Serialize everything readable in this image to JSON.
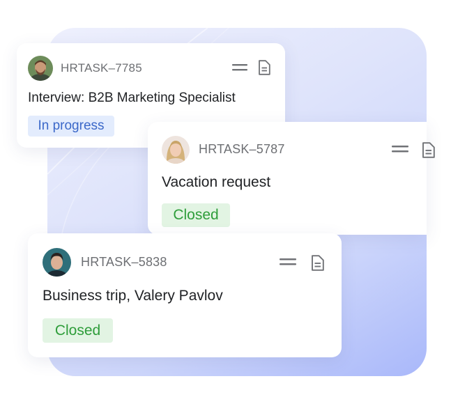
{
  "colors": {
    "badge_in_progress_bg": "#e3ecfd",
    "badge_in_progress_text": "#3b68c9",
    "badge_closed_bg": "#e2f4e3",
    "badge_closed_text": "#2e9d3a",
    "backdrop_accent": "#a9b8fa"
  },
  "cards": [
    {
      "task_id": "HRTASK–7785",
      "title": "Interview: B2B Marketing Specialist",
      "status": "In progress",
      "avatar": "man-with-beard-avatar",
      "icons": [
        "drag-handle-icon",
        "document-icon"
      ]
    },
    {
      "task_id": "HRTASK–5787",
      "title": "Vacation request",
      "status": "Closed",
      "avatar": "woman-blonde-avatar",
      "icons": [
        "drag-handle-icon",
        "document-icon"
      ]
    },
    {
      "task_id": "HRTASK–5838",
      "title": "Business trip, Valery Pavlov",
      "status": "Closed",
      "avatar": "man-dark-hair-avatar",
      "icons": [
        "drag-handle-icon",
        "document-icon"
      ]
    }
  ]
}
